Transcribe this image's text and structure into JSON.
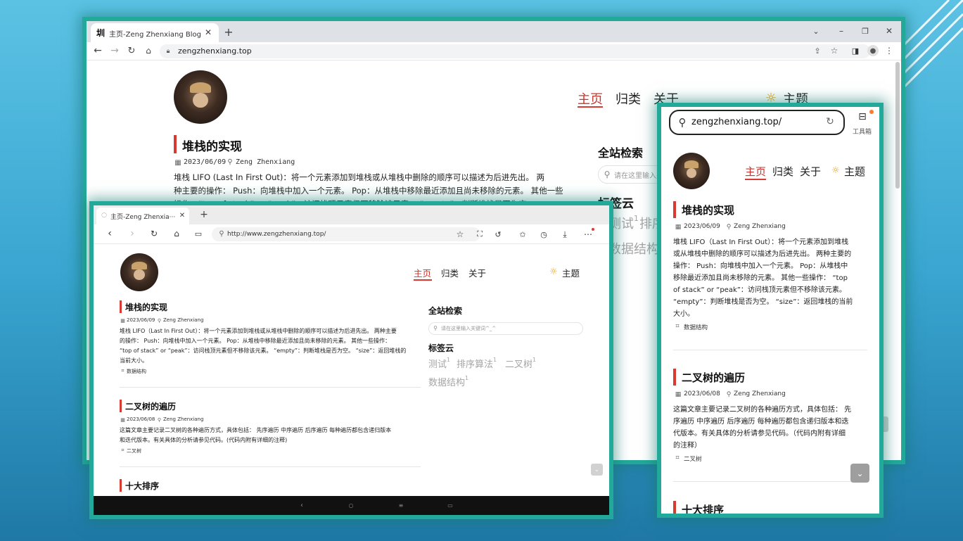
{
  "desktop": {
    "tab_title": "主页-Zeng Zhenxiang Blog",
    "tab_favicon": "圳",
    "url": "zengzhenxiang.top",
    "nav": [
      "主页",
      "归类",
      "关于"
    ],
    "theme": "主题",
    "post": {
      "title": "堆栈的实现",
      "date": "2023/06/09",
      "author": "Zeng Zhenxiang",
      "line1": "堆栈 LIFO (Last In First Out)：将一个元素添加到堆栈或从堆栈中删除的顺序可以描述为后进先出。 两",
      "line2": "种主要的操作： Push：向堆栈中加入一个元素。 Pop：从堆栈中移除最近添加且尚未移除的元素。 其他一些",
      "line3": "操作：“top of stack” or “peak”：访问栈顶元素但不移除该元素。 “empty”：判断堆栈是否为空"
    },
    "search_title": "全站检索",
    "search_placeholder": "请在这里输入关",
    "tagcloud_title": "标签云",
    "tags": [
      "测试",
      "排序",
      "数据结构"
    ],
    "sup": "1"
  },
  "edge": {
    "tab_title": "主页-Zeng Zhenxia···",
    "url": "http://www.zengzhenxiang.top/",
    "nav": [
      "主页",
      "归类",
      "关于"
    ],
    "theme": "主题",
    "posts": [
      {
        "title": "堆栈的实现",
        "date": "2023/06/09",
        "author": "Zeng Zhenxiang",
        "lines": [
          "堆栈 LIFO（Last In First Out）：将一个元素添加到堆栈或从堆栈中删除的顺序可以描述为后进先出。 两种主要",
          "的操作： Push：向堆栈中加入一个元素。 Pop：从堆栈中移除最近添加且尚未移除的元素。 其他一些操作：",
          "“top of stack” or “peak”：访问栈顶元素但不移除该元素。 “empty”：判断堆栈是否为空。 “size”：返回堆栈的",
          "当前大小。"
        ],
        "tag": "数据结构"
      },
      {
        "title": "二叉树的遍历",
        "date": "2023/06/08",
        "author": "Zeng Zhenxiang",
        "lines": [
          "这篇文章主要记录二叉树的各种遍历方式，具体包括： 先序遍历 中序遍历 后序遍历 每种遍历都包含递归版本",
          "和迭代版本。有关具体的分析请参见代码。(代码内附有详细的注释)"
        ],
        "tag": "二叉树"
      },
      {
        "title": "十大排序"
      }
    ],
    "search_title": "全站检索",
    "search_placeholder": "请在这里输入关键词^_^",
    "tagcloud_title": "标签云",
    "tags": [
      "测试",
      "排序算法",
      "二叉树",
      "数据结构"
    ],
    "sup": "1"
  },
  "phone": {
    "url": "zengzhenxiang.top/",
    "toolbox": "工具箱",
    "nav": [
      "主页",
      "归类",
      "关于"
    ],
    "theme": "主题",
    "posts": [
      {
        "title": "堆栈的实现",
        "date": "2023/06/09",
        "author": "Zeng Zhenxiang",
        "lines": [
          "堆栈 LIFO（Last In First Out）：将一个元素添加到堆栈",
          "或从堆栈中删除的顺序可以描述为后进先出。 两种主要的",
          "操作： Push：向堆栈中加入一个元素。 Pop：从堆栈中",
          "移除最近添加且尚未移除的元素。 其他一些操作： “top",
          "of stack” or “peak”：访问栈顶元素但不移除该元素。",
          "“empty”：判断堆栈是否为空。 “size”：返回堆栈的当前",
          "大小。"
        ],
        "tag": "数据结构"
      },
      {
        "title": "二叉树的遍历",
        "date": "2023/06/08",
        "author": "Zeng Zhenxiang",
        "lines": [
          "这篇文章主要记录二叉树的各种遍历方式，具体包括： 先",
          "序遍历 中序遍历 后序遍历 每种遍历都包含递归版本和迭",
          "代版本。有关具体的分析请参见代码。（代码内附有详细",
          "的注释）"
        ],
        "tag": "二叉树"
      },
      {
        "title": "十大排序"
      }
    ]
  },
  "colors": {
    "accent": "#d93a30",
    "frame": "#22a99a"
  }
}
